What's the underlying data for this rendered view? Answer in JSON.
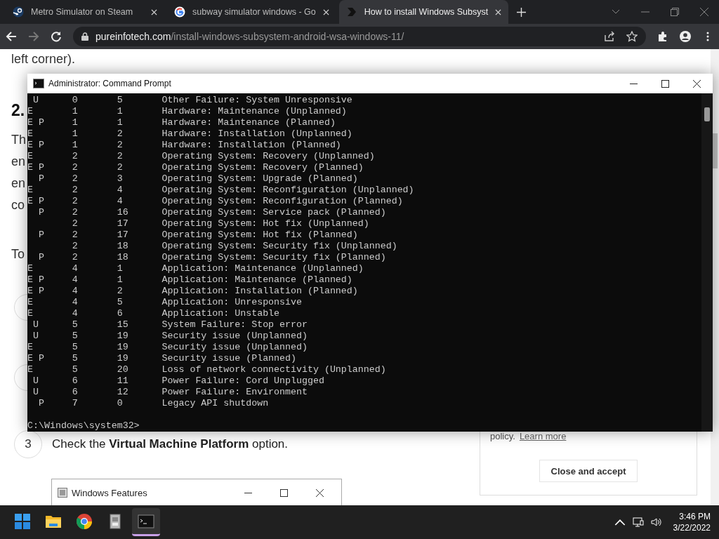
{
  "browser": {
    "tabs": [
      {
        "title": "Metro Simulator on Steam",
        "selected": false
      },
      {
        "title": "subway simulator windows - Go",
        "selected": false
      },
      {
        "title": "How to install Windows Subsyst",
        "selected": true
      }
    ],
    "url_host": "pureinfotech.com",
    "url_path": "/install-windows-subsystem-android-wsa-windows-11/"
  },
  "page": {
    "fragments": [
      {
        "kind": "text",
        "text": "left corner)."
      },
      {
        "kind": "heading",
        "text": "2."
      },
      {
        "kind": "text",
        "text": "Th"
      },
      {
        "kind": "text",
        "text": "en"
      },
      {
        "kind": "text",
        "text": "en"
      },
      {
        "kind": "text",
        "text": "co"
      },
      {
        "kind": "text",
        "text": "To"
      }
    ],
    "step": {
      "number": "3",
      "text": "Check the **Virtual Machine Platform** option."
    },
    "embedded_window": {
      "title": "Windows Features"
    },
    "cookie": {
      "text": "policy.",
      "link": "Learn more",
      "button": "Close and accept"
    }
  },
  "cmd": {
    "title": "Administrator: Command Prompt",
    "rows": [
      {
        "flags": " U",
        "major": "0",
        "minor": "5",
        "reason": "Other Failure: System Unresponsive"
      },
      {
        "flags": "E",
        "major": "1",
        "minor": "1",
        "reason": "Hardware: Maintenance (Unplanned)"
      },
      {
        "flags": "E P",
        "major": "1",
        "minor": "1",
        "reason": "Hardware: Maintenance (Planned)"
      },
      {
        "flags": "E",
        "major": "1",
        "minor": "2",
        "reason": "Hardware: Installation (Unplanned)"
      },
      {
        "flags": "E P",
        "major": "1",
        "minor": "2",
        "reason": "Hardware: Installation (Planned)"
      },
      {
        "flags": "E",
        "major": "2",
        "minor": "2",
        "reason": "Operating System: Recovery (Unplanned)"
      },
      {
        "flags": "E P",
        "major": "2",
        "minor": "2",
        "reason": "Operating System: Recovery (Planned)"
      },
      {
        "flags": "  P",
        "major": "2",
        "minor": "3",
        "reason": "Operating System: Upgrade (Planned)"
      },
      {
        "flags": "E",
        "major": "2",
        "minor": "4",
        "reason": "Operating System: Reconfiguration (Unplanned)"
      },
      {
        "flags": "E P",
        "major": "2",
        "minor": "4",
        "reason": "Operating System: Reconfiguration (Planned)"
      },
      {
        "flags": "  P",
        "major": "2",
        "minor": "16",
        "reason": "Operating System: Service pack (Planned)"
      },
      {
        "flags": "",
        "major": "2",
        "minor": "17",
        "reason": "Operating System: Hot fix (Unplanned)"
      },
      {
        "flags": "  P",
        "major": "2",
        "minor": "17",
        "reason": "Operating System: Hot fix (Planned)"
      },
      {
        "flags": "",
        "major": "2",
        "minor": "18",
        "reason": "Operating System: Security fix (Unplanned)"
      },
      {
        "flags": "  P",
        "major": "2",
        "minor": "18",
        "reason": "Operating System: Security fix (Planned)"
      },
      {
        "flags": "E",
        "major": "4",
        "minor": "1",
        "reason": "Application: Maintenance (Unplanned)"
      },
      {
        "flags": "E P",
        "major": "4",
        "minor": "1",
        "reason": "Application: Maintenance (Planned)"
      },
      {
        "flags": "E P",
        "major": "4",
        "minor": "2",
        "reason": "Application: Installation (Planned)"
      },
      {
        "flags": "E",
        "major": "4",
        "minor": "5",
        "reason": "Application: Unresponsive"
      },
      {
        "flags": "E",
        "major": "4",
        "minor": "6",
        "reason": "Application: Unstable"
      },
      {
        "flags": " U",
        "major": "5",
        "minor": "15",
        "reason": "System Failure: Stop error"
      },
      {
        "flags": " U",
        "major": "5",
        "minor": "19",
        "reason": "Security issue (Unplanned)"
      },
      {
        "flags": "E",
        "major": "5",
        "minor": "19",
        "reason": "Security issue (Unplanned)"
      },
      {
        "flags": "E P",
        "major": "5",
        "minor": "19",
        "reason": "Security issue (Planned)"
      },
      {
        "flags": "E",
        "major": "5",
        "minor": "20",
        "reason": "Loss of network connectivity (Unplanned)"
      },
      {
        "flags": " U",
        "major": "6",
        "minor": "11",
        "reason": "Power Failure: Cord Unplugged"
      },
      {
        "flags": " U",
        "major": "6",
        "minor": "12",
        "reason": "Power Failure: Environment"
      },
      {
        "flags": "  P",
        "major": "7",
        "minor": "0",
        "reason": "Legacy API shutdown"
      }
    ],
    "prompt": "C:\\Windows\\system32>"
  },
  "taskbar": {
    "apps": [
      {
        "kind": "start",
        "selected": false
      },
      {
        "kind": "folder",
        "selected": false
      },
      {
        "kind": "chrome",
        "selected": false
      },
      {
        "kind": "app",
        "selected": false
      },
      {
        "kind": "terminal",
        "selected": true
      }
    ],
    "time": "3:46 PM",
    "date": "3/22/2022"
  }
}
